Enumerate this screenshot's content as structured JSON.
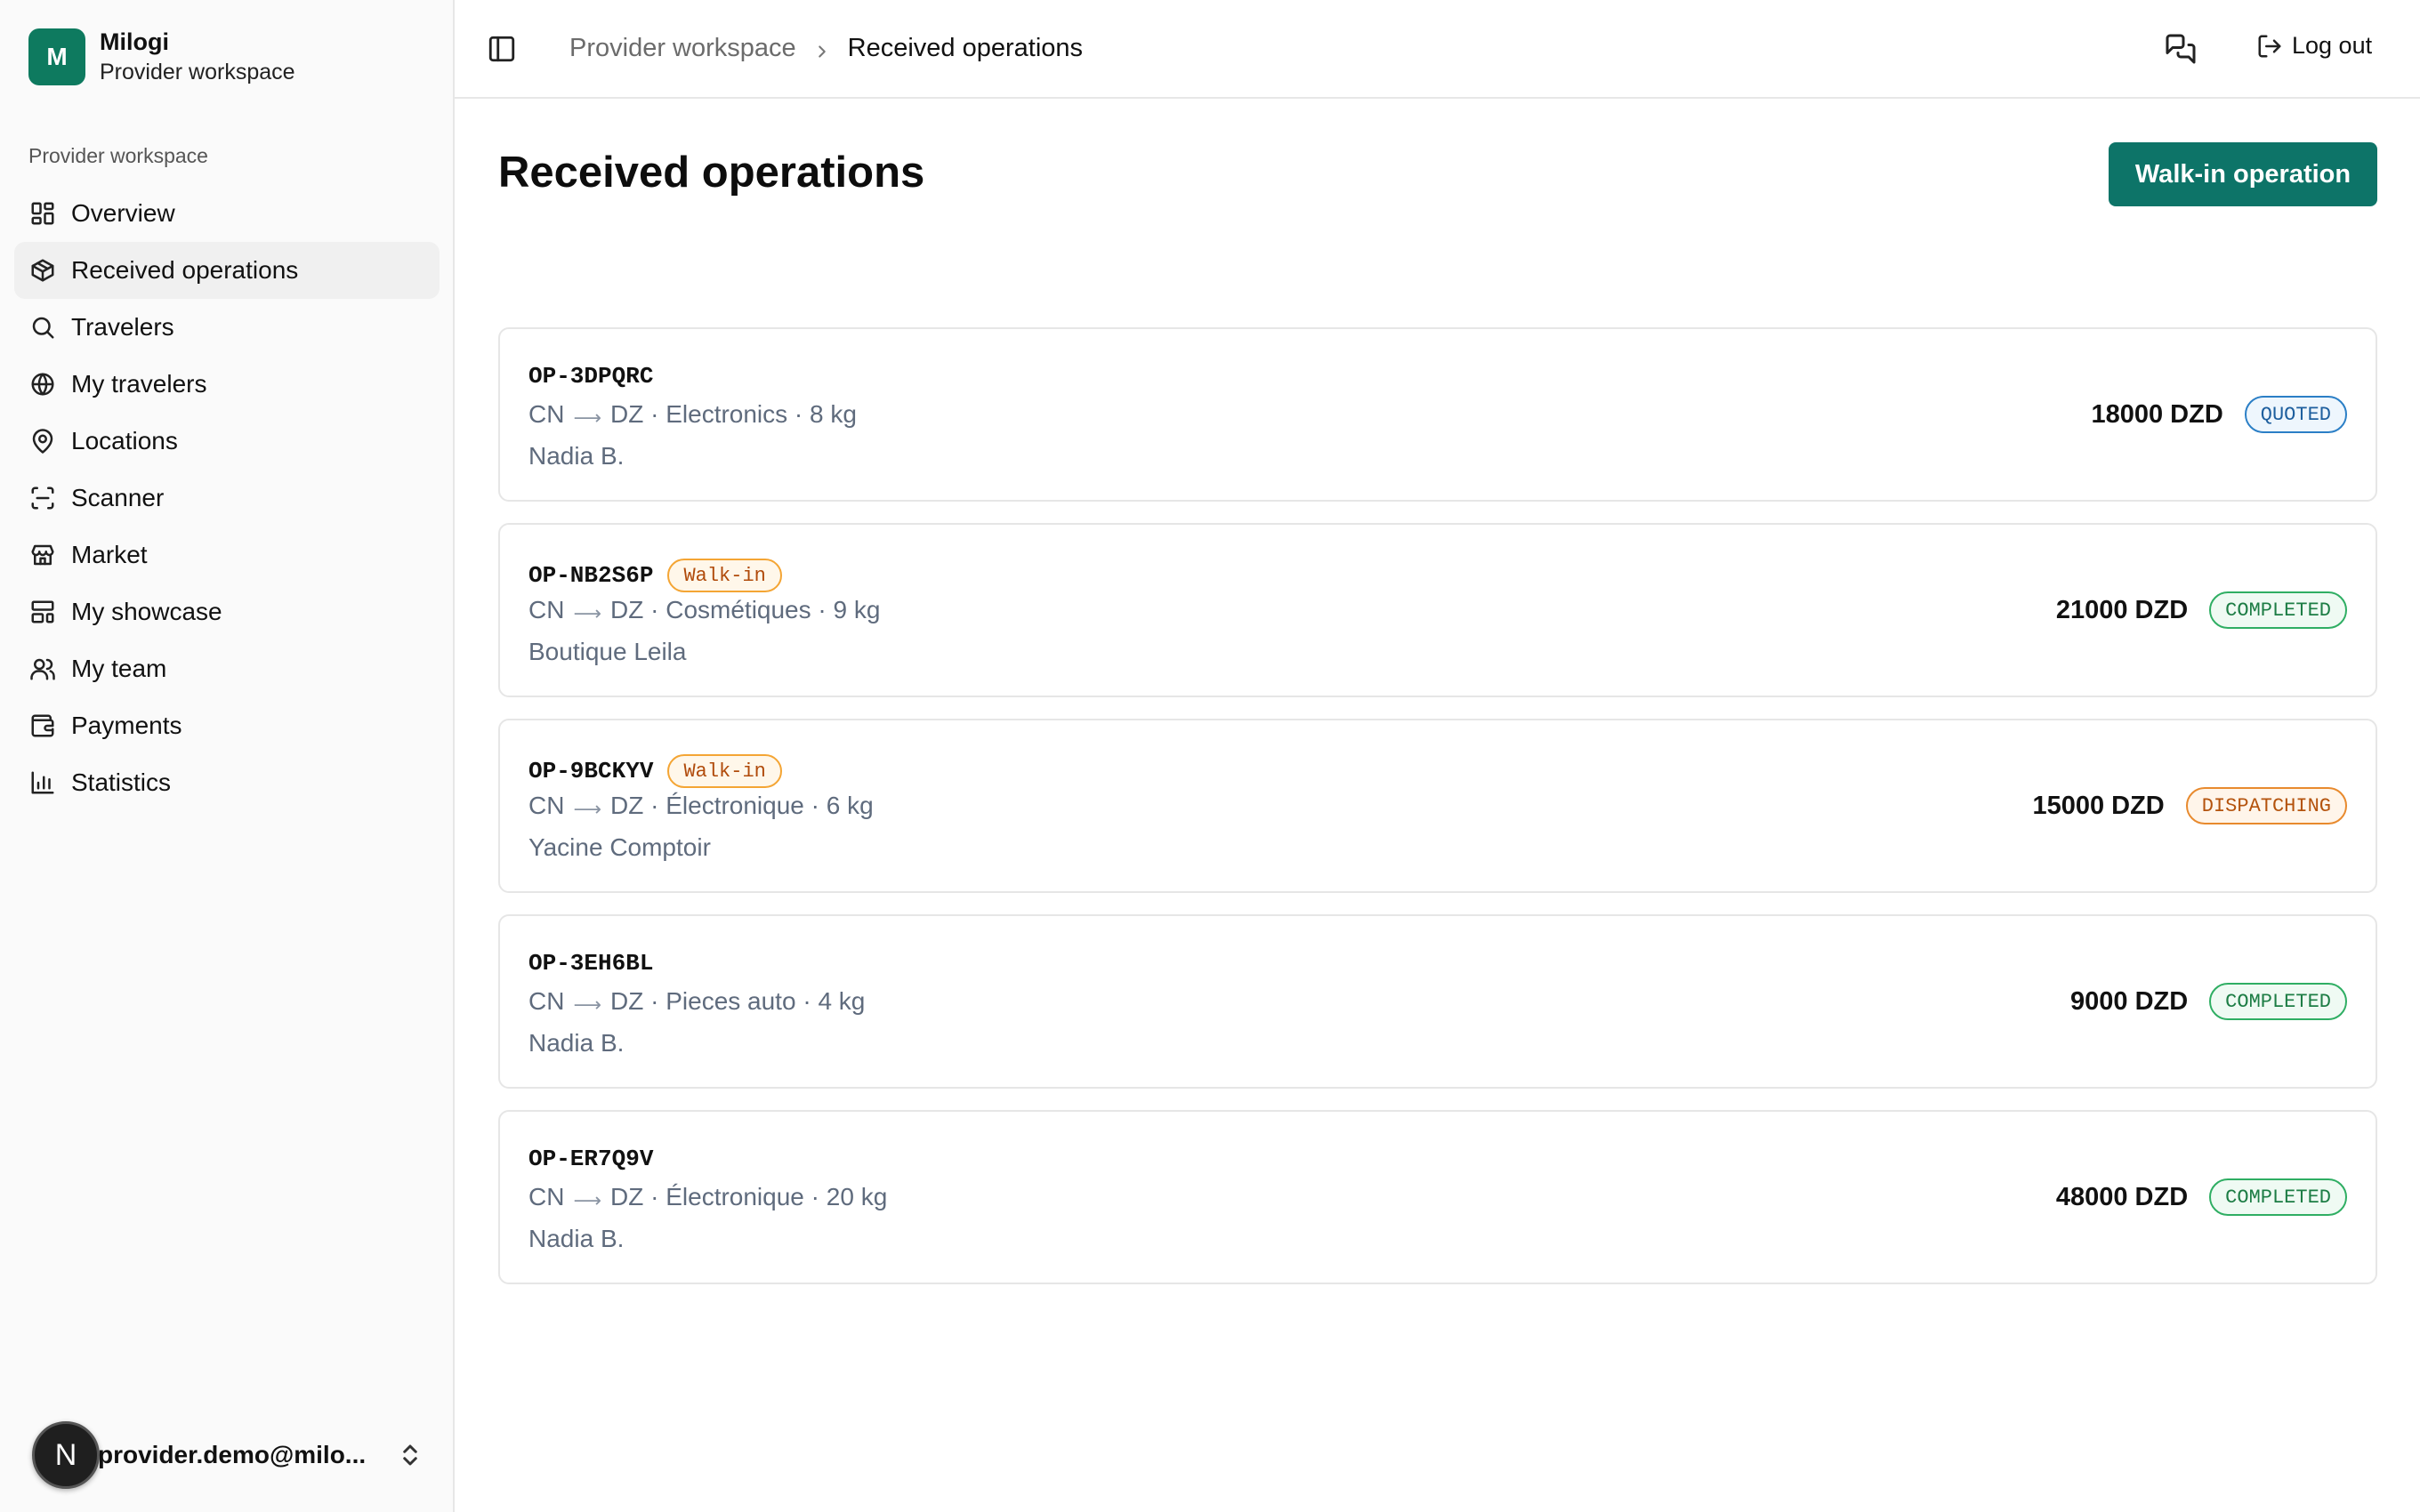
{
  "brand": {
    "initial": "M",
    "name": "Milogi",
    "subtitle": "Provider workspace"
  },
  "sidebar": {
    "section_label": "Provider workspace",
    "items": [
      {
        "label": "Overview",
        "icon": "layout-dashboard-icon",
        "active": false
      },
      {
        "label": "Received operations",
        "icon": "package-icon",
        "active": true
      },
      {
        "label": "Travelers",
        "icon": "search-icon",
        "active": false
      },
      {
        "label": "My travelers",
        "icon": "globe-icon",
        "active": false
      },
      {
        "label": "Locations",
        "icon": "map-pin-icon",
        "active": false
      },
      {
        "label": "Scanner",
        "icon": "scan-icon",
        "active": false
      },
      {
        "label": "Market",
        "icon": "store-icon",
        "active": false
      },
      {
        "label": "My showcase",
        "icon": "layout-template-icon",
        "active": false
      },
      {
        "label": "My team",
        "icon": "users-icon",
        "active": false
      },
      {
        "label": "Payments",
        "icon": "wallet-icon",
        "active": false
      },
      {
        "label": "Statistics",
        "icon": "bar-chart-icon",
        "active": false
      }
    ],
    "user": {
      "avatar_initial": "N",
      "email": "provider.demo@milo..."
    }
  },
  "header": {
    "breadcrumb_parent": "Provider workspace",
    "breadcrumb_current": "Received operations",
    "logout_label": "Log out"
  },
  "main": {
    "title": "Received operations",
    "primary_action": "Walk-in operation",
    "operations": [
      {
        "code": "OP-3DPQRC",
        "walk_in": false,
        "origin": "CN",
        "destination": "DZ",
        "category": "Electronics",
        "weight": "8 kg",
        "client": "Nadia B.",
        "amount": "18000 DZD",
        "status": "QUOTED",
        "status_kind": "quoted"
      },
      {
        "code": "OP-NB2S6P",
        "walk_in": true,
        "walk_in_label": "Walk-in",
        "origin": "CN",
        "destination": "DZ",
        "category": "Cosmétiques",
        "weight": "9 kg",
        "client": "Boutique Leila",
        "amount": "21000 DZD",
        "status": "COMPLETED",
        "status_kind": "completed"
      },
      {
        "code": "OP-9BCKYV",
        "walk_in": true,
        "walk_in_label": "Walk-in",
        "origin": "CN",
        "destination": "DZ",
        "category": "Électronique",
        "weight": "6 kg",
        "client": "Yacine Comptoir",
        "amount": "15000 DZD",
        "status": "DISPATCHING",
        "status_kind": "dispatching"
      },
      {
        "code": "OP-3EH6BL",
        "walk_in": false,
        "origin": "CN",
        "destination": "DZ",
        "category": "Pieces auto",
        "weight": "4 kg",
        "client": "Nadia B.",
        "amount": "9000 DZD",
        "status": "COMPLETED",
        "status_kind": "completed"
      },
      {
        "code": "OP-ER7Q9V",
        "walk_in": false,
        "origin": "CN",
        "destination": "DZ",
        "category": "Électronique",
        "weight": "20 kg",
        "client": "Nadia B.",
        "amount": "48000 DZD",
        "status": "COMPLETED",
        "status_kind": "completed"
      }
    ]
  },
  "colors": {
    "brand": "#0e7a5f",
    "primary_button": "#0d7468",
    "walk_in": "#f4a534",
    "quoted": "#2b7fc6",
    "completed": "#2fae63",
    "dispatching": "#e88a2e"
  }
}
